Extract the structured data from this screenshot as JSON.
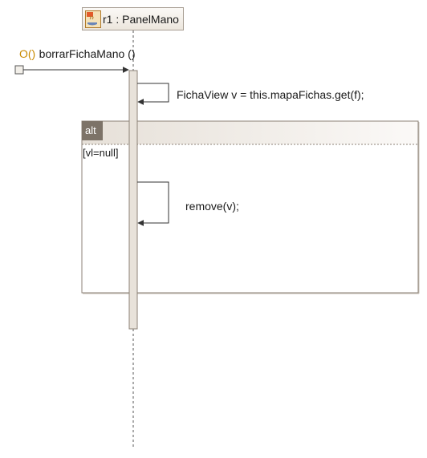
{
  "lifeline": {
    "label": "r1 : PanelMano",
    "icon": "java-class-icon"
  },
  "found_message": {
    "prefix": "O()",
    "label": "borrarFichaMano ()"
  },
  "self_messages": [
    {
      "label": "FichaView v = this.mapaFichas.get(f);"
    },
    {
      "label": "remove(v);"
    }
  ],
  "fragment": {
    "operator": "alt",
    "guard": "[vl=null]"
  },
  "colors": {
    "frame": "#a89f94",
    "activation": "#e8e2da",
    "tab": "#7d7368",
    "prefix": "#c98a00"
  }
}
